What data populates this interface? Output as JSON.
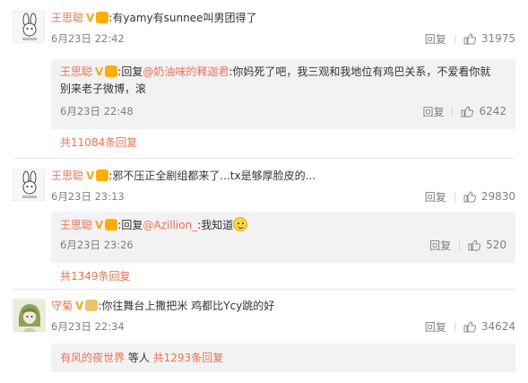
{
  "comments": [
    {
      "user": "王思聪",
      "verified_mark": "V",
      "text": "有yamy有sunnee叫男团得了",
      "time": "6月23日 22:42",
      "reply_label": "回复",
      "likes": "31975",
      "sub": {
        "user": "王思聪",
        "verified_mark": "V",
        "reply_prefix": "回复",
        "mention": "@奶油味的释迦君",
        "text_line1": ":你妈死了吧，我三观和我地位有鸡巴关系，不爱看你就",
        "text_line2": "别来老子微博，滚",
        "time": "6月23日 22:48",
        "reply_label": "回复",
        "likes": "6242"
      },
      "more": "共11084条回复"
    },
    {
      "user": "王思聪",
      "verified_mark": "V",
      "text": "邪不压正全剧组都来了...tx是够厚脸皮的...",
      "time": "6月23日 23:13",
      "reply_label": "回复",
      "likes": "29830",
      "sub": {
        "user": "王思聪",
        "verified_mark": "V",
        "reply_prefix": "回复",
        "mention": "@Azillion_",
        "text_line1": ":我知道",
        "time": "6月23日 23:26",
        "reply_label": "回复",
        "likes": "520"
      },
      "more": "共1349条回复"
    },
    {
      "user": "守菊",
      "verified_mark": "V",
      "text": "你往舞台上撒把米 鸡都比Ycy跳的好",
      "time": "6月23日 22:34",
      "reply_label": "回复",
      "likes": "34624",
      "more_user": "有风的夜世界",
      "more_mid": " 等人 ",
      "more": "共1293条回复"
    }
  ],
  "colors": {
    "name": "#eb7350",
    "meta": "#808080",
    "subbox_bg": "#f2f2f5",
    "verified": "#f5a623"
  },
  "icons": [
    "rabbit-avatar-icon",
    "verified-v-icon",
    "badge-icon",
    "thumb-up-icon",
    "smile-emoji-icon",
    "anime-avatar-icon"
  ]
}
